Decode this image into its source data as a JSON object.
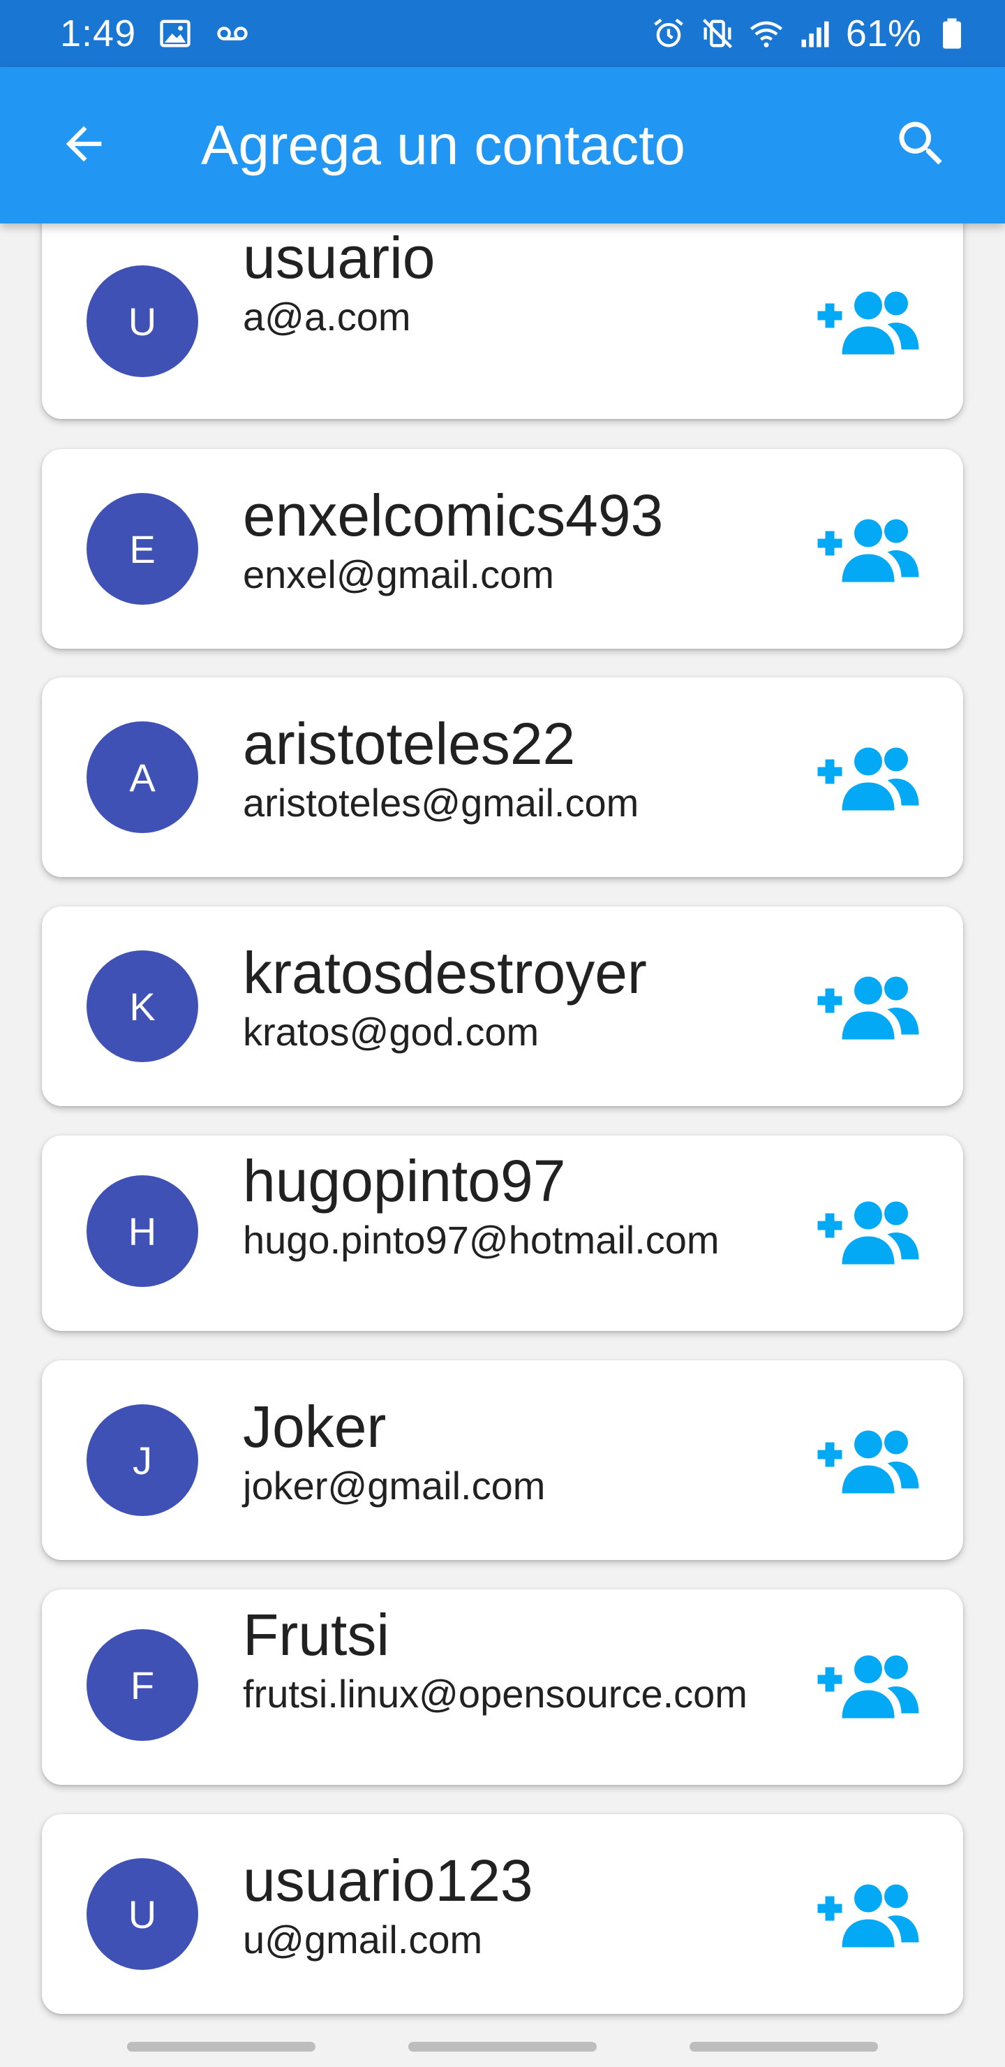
{
  "status_bar": {
    "time": "1:49",
    "battery": "61%",
    "icons": [
      "image-icon",
      "voicemail-icon",
      "alarm-icon",
      "vibrate-mute-icon",
      "wifi-icon",
      "signal-icon",
      "battery-icon"
    ]
  },
  "app_bar": {
    "title": "Agrega un contacto",
    "back_icon": "arrow-back-icon",
    "search_icon": "search-icon"
  },
  "colors": {
    "status_bar": "#1976d2",
    "app_bar": "#2196f3",
    "avatar": "#3f51b5",
    "add_icon": "#03a9f4",
    "background": "#f2f2f2"
  },
  "contacts": [
    {
      "initial": "U",
      "name": "usuario",
      "email": "a@a.com"
    },
    {
      "initial": "E",
      "name": "enxelcomics493",
      "email": "enxel@gmail.com"
    },
    {
      "initial": "A",
      "name": "aristoteles22",
      "email": "aristoteles@gmail.com"
    },
    {
      "initial": "K",
      "name": "kratosdestroyer",
      "email": "kratos@god.com"
    },
    {
      "initial": "H",
      "name": "hugopinto97",
      "email": "hugo.pinto97@hotmail.com"
    },
    {
      "initial": "J",
      "name": "Joker",
      "email": "joker@gmail.com"
    },
    {
      "initial": "F",
      "name": "Frutsi",
      "email": "frutsi.linux@opensource.com"
    },
    {
      "initial": "U",
      "name": "usuario123",
      "email": "u@gmail.com"
    }
  ],
  "add_contact_icon": "group-add-icon"
}
